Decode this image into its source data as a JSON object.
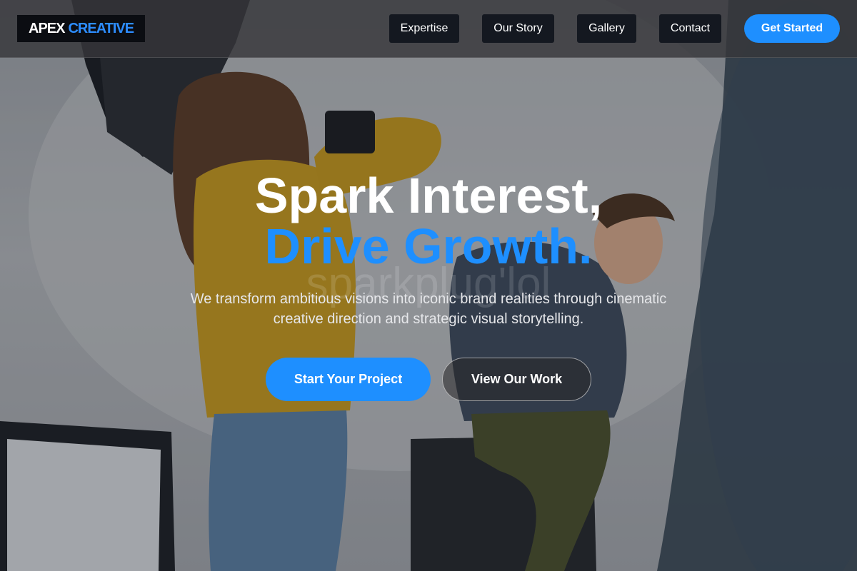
{
  "brand": {
    "part1": "APEX",
    "part2": "CREATIVE"
  },
  "nav": {
    "links": [
      {
        "label": "Expertise"
      },
      {
        "label": "Our Story"
      },
      {
        "label": "Gallery"
      },
      {
        "label": "Contact"
      }
    ],
    "cta_label": "Get Started"
  },
  "hero": {
    "headline_line1": "Spark Interest,",
    "headline_line2": "Drive Growth.",
    "watermark": "sparkplug'lol",
    "subtext": "We transform ambitious visions into iconic brand realities through cinematic creative direction and strategic visual storytelling.",
    "primary_button": "Start Your Project",
    "secondary_button": "View Our Work",
    "background_image": "photo studio: photographer in yellow sweater shooting a model in denim jacket seated on a black box"
  },
  "colors": {
    "accent": "#1e8fff",
    "nav_bg": "#37373a",
    "nav_link_bg": "#141820",
    "logo_bg": "#0b0d12",
    "text_light": "#ffffff"
  }
}
